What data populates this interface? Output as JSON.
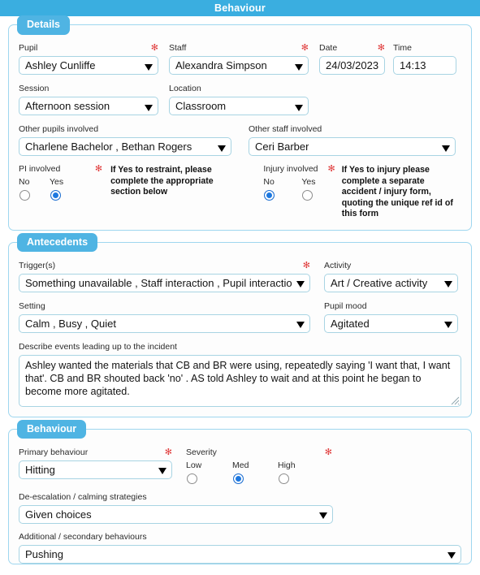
{
  "titlebar": {
    "title": "Behaviour"
  },
  "panels": {
    "details": {
      "legend": "Details",
      "pupil": {
        "label": "Pupil",
        "value": "Ashley Cunliffe",
        "required": "✻"
      },
      "staff": {
        "label": "Staff",
        "value": "Alexandra Simpson",
        "required": "✻"
      },
      "date": {
        "label": "Date",
        "value": "24/03/2023",
        "required": "✻"
      },
      "time": {
        "label": "Time",
        "value": "14:13"
      },
      "session": {
        "label": "Session",
        "value": "Afternoon session"
      },
      "location": {
        "label": "Location",
        "value": "Classroom"
      },
      "other_pupils": {
        "label": "Other pupils involved",
        "value": "Charlene Bachelor , Bethan Rogers"
      },
      "other_staff": {
        "label": "Other staff involved",
        "value": "Ceri Barber"
      },
      "pi_involved": {
        "label": "PI involved",
        "required": "✻",
        "options": [
          "No",
          "Yes"
        ],
        "selected": "Yes",
        "note": "If Yes to restraint, please complete the appropriate section below"
      },
      "injury_involved": {
        "label": "Injury involved",
        "required": "✻",
        "options": [
          "No",
          "Yes"
        ],
        "selected": "No",
        "note": "If Yes to injury please complete a separate accident / injury form, quoting the unique ref id of this form"
      }
    },
    "antecedents": {
      "legend": "Antecedents",
      "triggers": {
        "label": "Trigger(s)",
        "required": "✻",
        "value": "Something unavailable , Staff interaction , Pupil interaction"
      },
      "activity": {
        "label": "Activity",
        "value": "Art / Creative activity"
      },
      "setting": {
        "label": "Setting",
        "value": "Calm , Busy , Quiet"
      },
      "pupil_mood": {
        "label": "Pupil mood",
        "value": "Agitated"
      },
      "describe": {
        "label": "Describe events leading up to the incident",
        "value": "Ashley wanted the materials that CB and BR were using, repeatedly saying 'I want that, I want that'. CB and BR shouted back 'no' . AS told Ashley to wait and at this point he began to become more agitated."
      }
    },
    "behaviour": {
      "legend": "Behaviour",
      "primary": {
        "label": "Primary behaviour",
        "required": "✻",
        "value": "Hitting"
      },
      "severity": {
        "label": "Severity",
        "required": "✻",
        "options": [
          "Low",
          "Med",
          "High"
        ],
        "selected": "Med"
      },
      "deescalation": {
        "label": "De-escalation / calming strategies",
        "value": "Given choices"
      },
      "additional": {
        "label": "Additional / secondary behaviours",
        "value": "Pushing"
      }
    }
  },
  "colors": {
    "titlebar_bg": "#3aaee0",
    "legend_bg": "#4fb4e3",
    "panel_border": "#9fd7ef",
    "field_border": "#a8d4e3",
    "required": "#e03c3c",
    "radio_checked": "#1d78e0"
  }
}
